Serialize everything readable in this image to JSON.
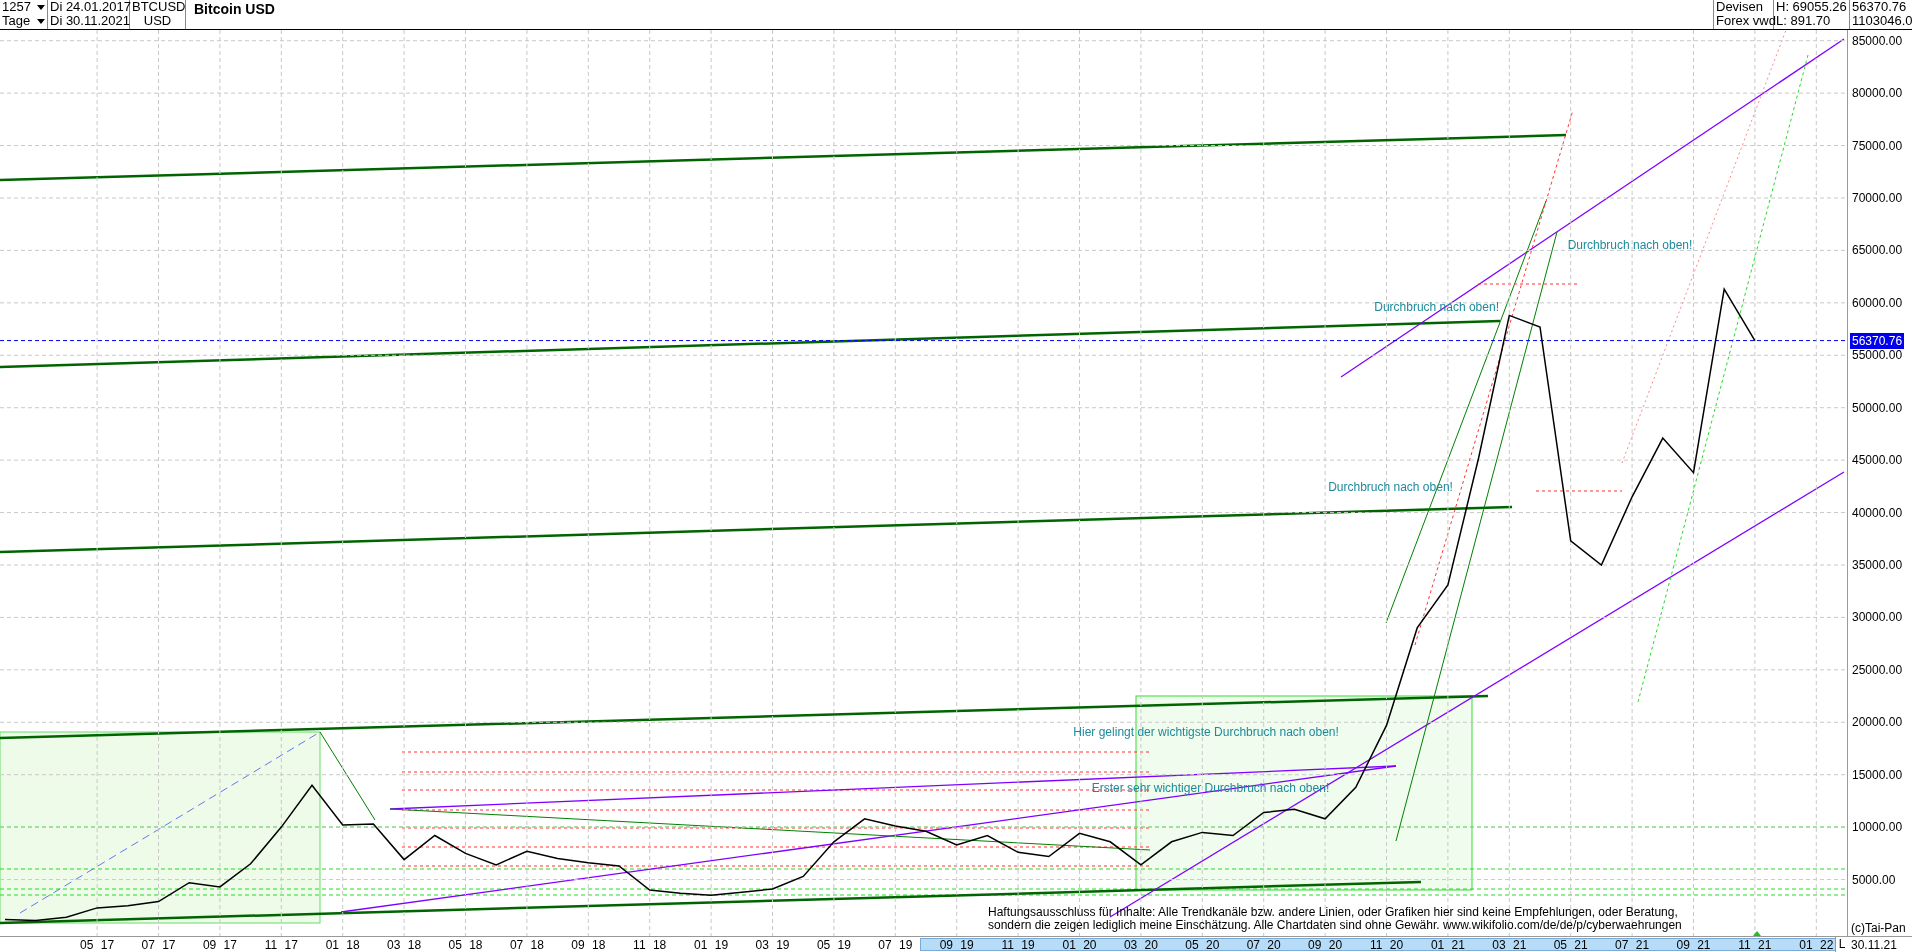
{
  "toolbar": {
    "period_count": "1257",
    "period_unit": "Tage",
    "start_date": "Di 24.01.2017",
    "end_date": "Di 30.11.2021",
    "symbol": "BTCUSD",
    "currency": "USD",
    "title": "Bitcoin USD",
    "market": "Devisen",
    "source": "Forex vwd",
    "high": "H: 69055.26",
    "low": "L: 891.70",
    "last": "56370.76",
    "volume": "1103046.0"
  },
  "chart": {
    "current_price_label": "56370.76",
    "copyright": "(c)Tai-Pan",
    "disclaimer": [
      "Haftungsausschluss für Inhalte: Alle Trendkanäle bzw. andere Linien, oder Grafiken hier sind keine Empfehlungen, oder Beratung,",
      "sondern die zeigen lediglich meine  Einschätzung. Alle Chartdaten sind ohne Gewähr.  www.wikifolio.com/de/de/p/cyberwaehrungen"
    ],
    "chart_data": {
      "type": "line",
      "categories": [
        null,
        null,
        null,
        "05 17",
        null,
        "07 17",
        null,
        "09 17",
        null,
        "11 17",
        null,
        "01 18",
        null,
        "03 18",
        null,
        "05 18",
        null,
        "07 18",
        null,
        "09 18",
        null,
        "11 18",
        null,
        "01 19",
        null,
        "03 19",
        null,
        "05 19",
        null,
        "07 19",
        null,
        "09 19",
        null,
        "11 19",
        null,
        "01 20",
        null,
        "03 20",
        null,
        "05 20",
        null,
        "07 20",
        null,
        "09 20",
        null,
        "11 20",
        null,
        "01 21",
        null,
        "03 21",
        null,
        "05 21",
        null,
        "07 21",
        null,
        "09 21",
        null,
        "11 21",
        null,
        "01 22"
      ],
      "series": [
        {
          "color": "#000000",
          "values": [
            1200,
            1100,
            1400,
            2300,
            2500,
            2900,
            4700,
            4300,
            6500,
            10000,
            14000,
            10200,
            10300,
            6900,
            9200,
            7500,
            6400,
            7700,
            7000,
            6600,
            6300,
            4000,
            3700,
            3500,
            3800,
            4100,
            5300,
            8600,
            10800,
            10100,
            9600,
            8300,
            9200,
            7600,
            7200,
            9400,
            8600,
            6400,
            8600,
            9500,
            9200,
            11400,
            11700,
            10800,
            13800,
            19700,
            29000,
            33100,
            45200,
            58800,
            57700,
            37300,
            35000,
            41500,
            47100,
            43800,
            61300,
            56400,
            null,
            null
          ]
        }
      ],
      "ylim": [
        0,
        86020
      ],
      "grid": true,
      "yticks": [
        {
          "value": 5000,
          "label": "5000.00"
        },
        {
          "value": 10000,
          "label": "10000.00"
        },
        {
          "value": 15000,
          "label": "15000.00"
        },
        {
          "value": 20000,
          "label": "20000.00"
        },
        {
          "value": 25000,
          "label": "25000.00"
        },
        {
          "value": 30000,
          "label": "30000.00"
        },
        {
          "value": 35000,
          "label": "35000.00"
        },
        {
          "value": 40000,
          "label": "40000.00"
        },
        {
          "value": 45000,
          "label": "45000.00"
        },
        {
          "value": 50000,
          "label": "50000.00"
        },
        {
          "value": 55000,
          "label": "55000.00"
        },
        {
          "value": 60000,
          "label": "60000.00"
        },
        {
          "value": 65000,
          "label": "65000.00"
        },
        {
          "value": 70000,
          "label": "70000.00"
        },
        {
          "value": 75000,
          "label": "75000.00"
        },
        {
          "value": 80000,
          "label": "80000.00"
        },
        {
          "value": 85000,
          "label": "85000.00"
        }
      ],
      "annotations": [
        "Durchbruch nach oben!",
        "Durchbruch nach oben!",
        "Durchbruch nach oben!",
        "Hier gelingt der wichtigste Durchbruch nach oben!",
        "Erster sehr wichtiger Durchbruch nach oben!"
      ]
    }
  },
  "time_axis": {
    "scale_mode": "L",
    "end_date": "30.11.21"
  }
}
